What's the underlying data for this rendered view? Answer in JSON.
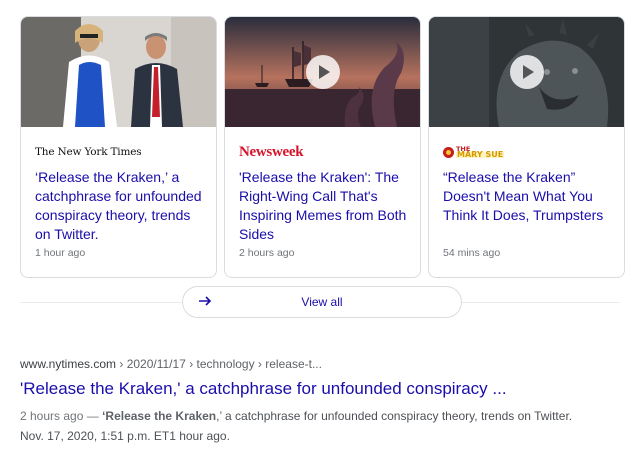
{
  "cards": [
    {
      "source": "The New York Times",
      "headline": "‘Release the Kraken,’ a catchphrase for unfounded conspiracy theory, trends on Twitter.",
      "time": "1 hour ago"
    },
    {
      "source": "Newsweek",
      "headline": "'Release the Kraken': The Right-Wing Call That's Inspiring Memes from Both Sides",
      "time": "2 hours ago"
    },
    {
      "source_top": "THE",
      "source_bottom": "MARY SUE",
      "headline": "“Release the Kraken” Doesn't Mean What You Think It Does, Trumpsters",
      "time": "54 mins ago"
    }
  ],
  "view_all": "View all",
  "result": {
    "domain": "www.nytimes.com",
    "path": [
      " › 2020/11/17",
      " › technology",
      " › release-t..."
    ],
    "title": "'Release the Kraken,' a catchphrase for unfounded conspiracy ...",
    "snippet_age": "2 hours ago — ",
    "snippet_bold": "‘Release the Kraken",
    "snippet_rest": ",’ a catchphrase for unfounded conspiracy theory, trends on Twitter. Nov. 17, 2020, 1:51 p.m. ET1 hour ago."
  },
  "colors": {
    "link": "#1a0dab",
    "newsweek": "#d6132b",
    "meta_gray": "#70757a"
  }
}
